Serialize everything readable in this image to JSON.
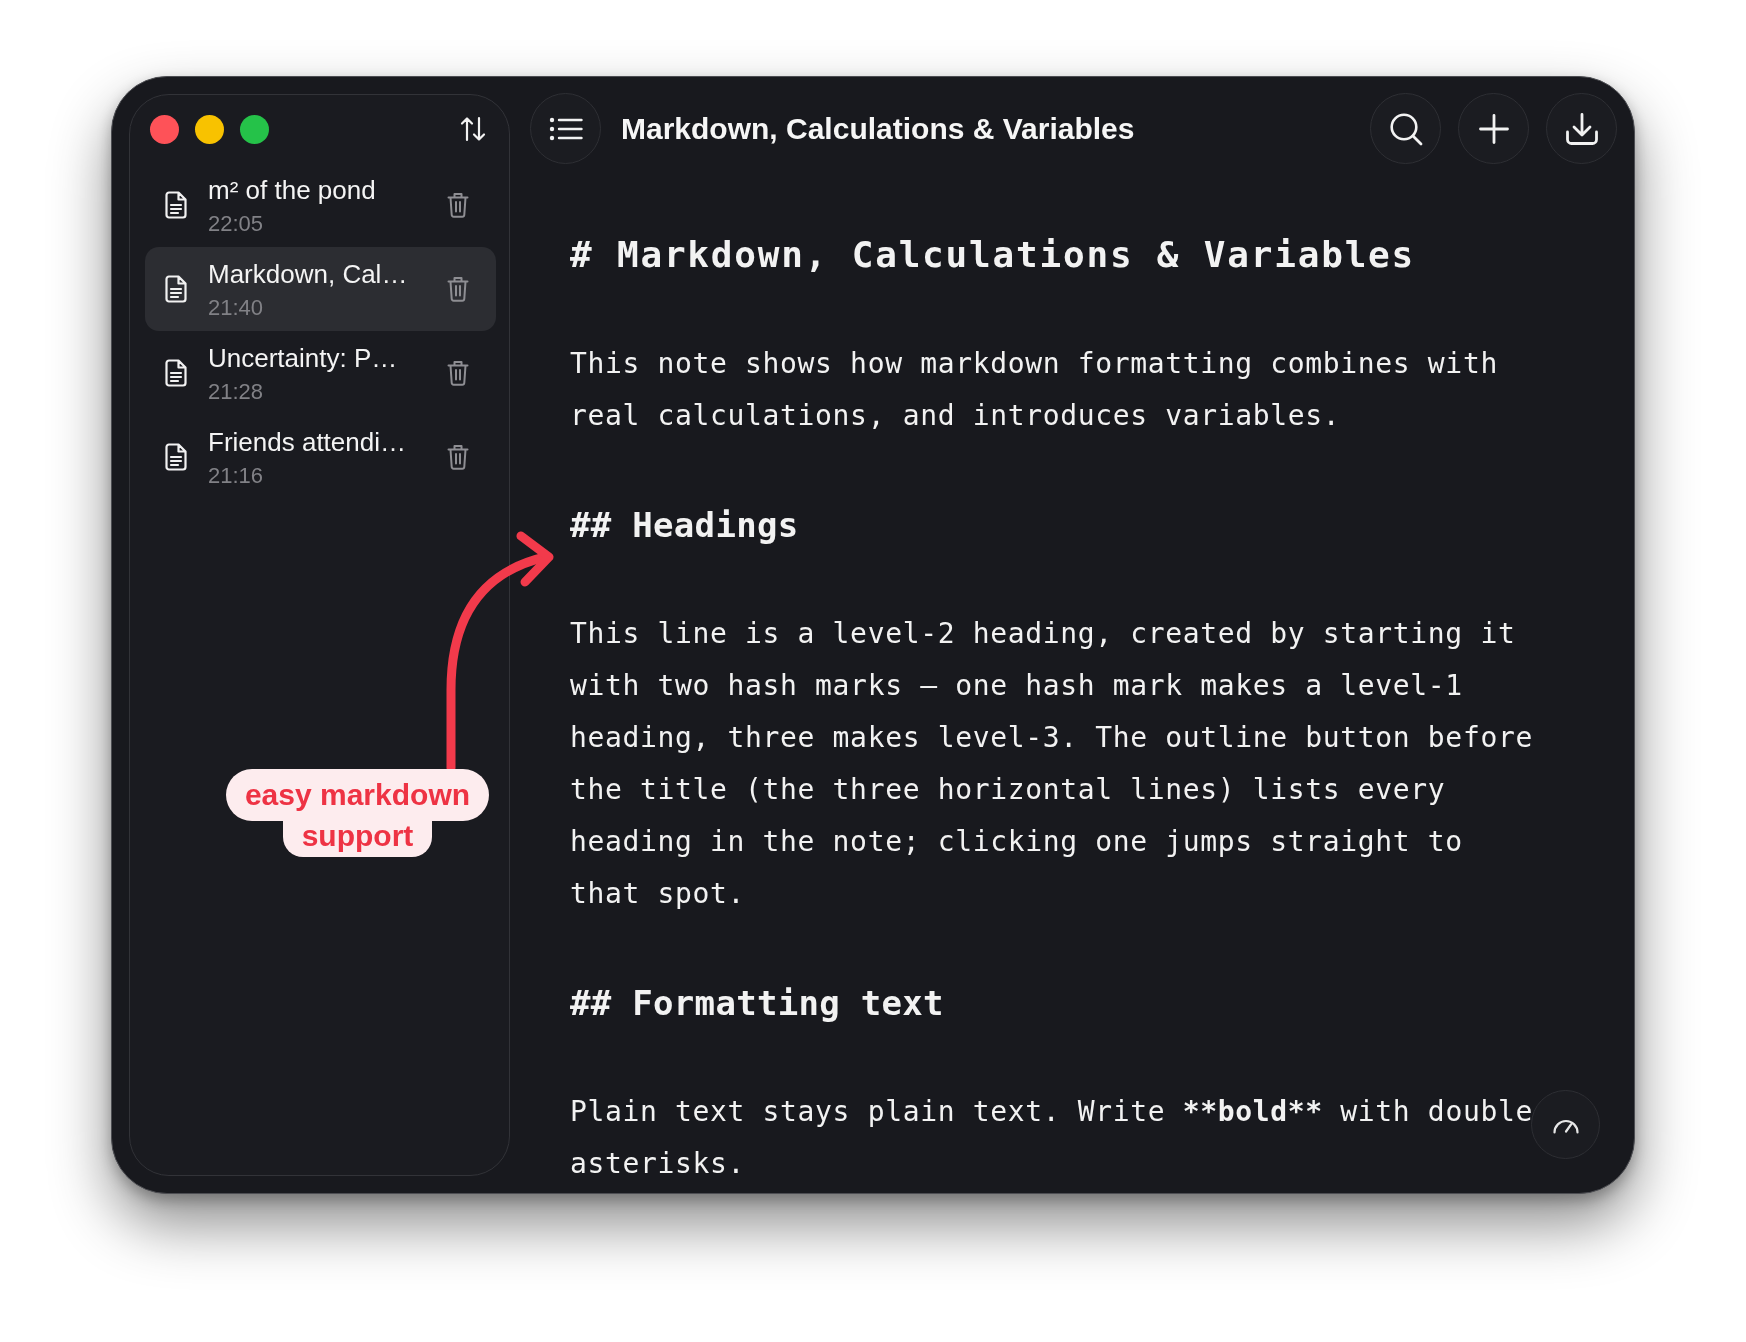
{
  "sidebar": {
    "items": [
      {
        "title": "m² of the pond",
        "time": "22:05",
        "selected": false
      },
      {
        "title": "Markdown, Cal…",
        "time": "21:40",
        "selected": true
      },
      {
        "title": "Uncertainty: P…",
        "time": "21:28",
        "selected": false
      },
      {
        "title": "Friends attendi…",
        "time": "21:16",
        "selected": false
      }
    ]
  },
  "header": {
    "title": "Markdown, Calculations & Variables"
  },
  "editor": {
    "blocks": [
      {
        "kind": "h1",
        "text": "# Markdown, Calculations & Variables"
      },
      {
        "kind": "paragraph",
        "segments": [
          {
            "text": "This note shows how markdown formatting combines with real calculations, and introduces variables.",
            "bold": false
          }
        ]
      },
      {
        "kind": "h2",
        "text": "## Headings"
      },
      {
        "kind": "paragraph",
        "segments": [
          {
            "text": "This line is a level-2 heading, created by starting it with two hash marks — one hash mark makes a level-1 heading, three makes level-3. The outline button before the title (the three horizontal lines) lists every heading in the note; clicking one jumps straight to that spot.",
            "bold": false
          }
        ]
      },
      {
        "kind": "h2",
        "text": "## Formatting text"
      },
      {
        "kind": "paragraph",
        "segments": [
          {
            "text": "Plain text stays plain text. Write ",
            "bold": false
          },
          {
            "text": "**bold**",
            "bold": true
          },
          {
            "text": " with double asterisks.",
            "bold": false
          }
        ]
      }
    ]
  },
  "annotation": {
    "lines": [
      "easy markdown",
      "support"
    ]
  }
}
